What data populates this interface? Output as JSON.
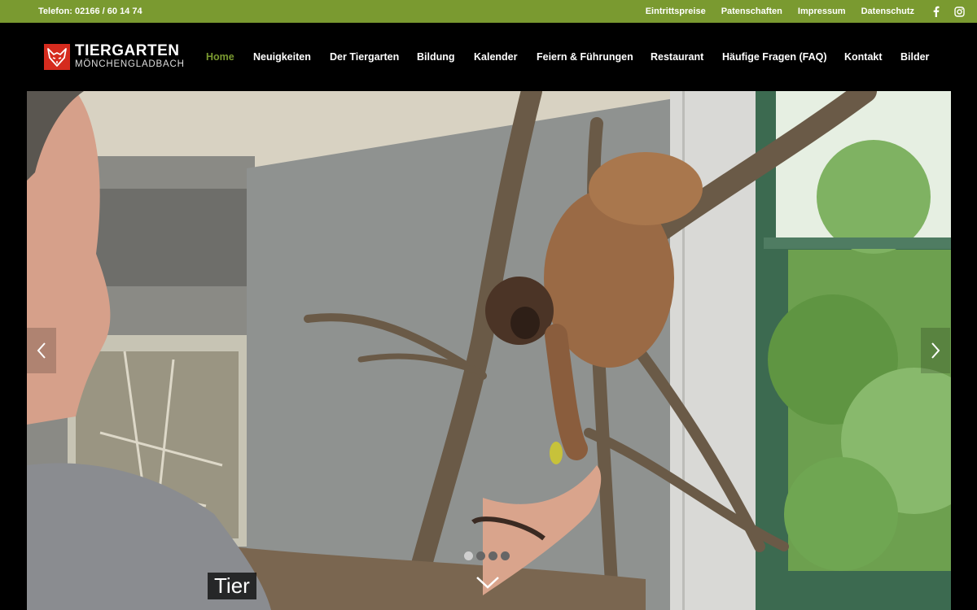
{
  "topbar": {
    "phone": "Telefon: 02166 / 60 14 74",
    "links": [
      "Eintrittspreise",
      "Patenschaften",
      "Impressum",
      "Datenschutz"
    ],
    "social": [
      {
        "icon": "facebook-icon"
      },
      {
        "icon": "instagram-icon"
      }
    ],
    "bg_color": "#7a9a30"
  },
  "header": {
    "logo_title": "TIERGARTEN",
    "logo_subtitle": "MÖNCHENGLADBACH",
    "logo_icon": "fox-head-icon",
    "brand_color": "#d52b1e"
  },
  "nav": {
    "items": [
      {
        "label": "Home",
        "active": true
      },
      {
        "label": "Neuigkeiten",
        "active": false
      },
      {
        "label": "Der Tiergarten",
        "active": false
      },
      {
        "label": "Bildung",
        "active": false
      },
      {
        "label": "Kalender",
        "active": false
      },
      {
        "label": "Feiern & Führungen",
        "active": false
      },
      {
        "label": "Restaurant",
        "active": false
      },
      {
        "label": "Häufige Fragen (FAQ)",
        "active": false
      },
      {
        "label": "Kontakt",
        "active": false
      },
      {
        "label": "Bilder",
        "active": false
      }
    ],
    "active_color": "#7a9a30"
  },
  "hero": {
    "caption": "Tier",
    "prev_icon": "chevron-left-icon",
    "next_icon": "chevron-right-icon",
    "scroll_icon": "chevron-down-icon",
    "slides_total": 4,
    "active_slide": 1
  }
}
